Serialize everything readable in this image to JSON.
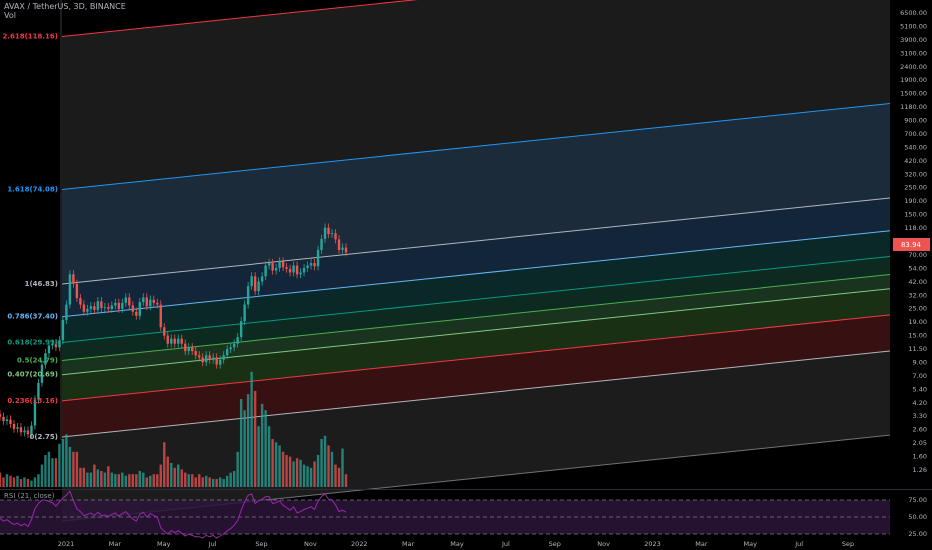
{
  "header": {
    "symbol_line": "AVAX / TetherUS, 3D, BINANCE",
    "volume_label": "Vol"
  },
  "price_badge": "83.94",
  "rsi": {
    "label": "RSI (21, close)",
    "ticks": [
      "75.00",
      "50.00",
      "25.00"
    ],
    "color": "#9c27b0"
  },
  "colors": {
    "up": "#26a69a",
    "down": "#ef5350",
    "volume_up": "#26a69a",
    "volume_down": "#ef5350",
    "badge": "#ef5350"
  },
  "chart_data": {
    "type": "candlestick-log-fib-channel",
    "symbol": "AVAX / TetherUS",
    "interval": "3D",
    "exchange": "BINANCE",
    "y_scale": "log",
    "fib_levels": [
      {
        "label": "0(2.75)",
        "ratio": 0,
        "price": 2.75,
        "color": "#b2b5be"
      },
      {
        "label": "0.236(13.16)",
        "ratio": 0.236,
        "price": 13.16,
        "color": "#f23645"
      },
      {
        "label": "0.407(20.69)",
        "ratio": 0.407,
        "price": 20.69,
        "color": "#81c784"
      },
      {
        "label": "0.5(24.79)",
        "ratio": 0.5,
        "price": 24.79,
        "color": "#4caf50"
      },
      {
        "label": "0.618(29.99)",
        "ratio": 0.618,
        "price": 29.99,
        "color": "#089981"
      },
      {
        "label": "0.786(37.40)",
        "ratio": 0.786,
        "price": 37.4,
        "color": "#64b5f6"
      },
      {
        "label": "1(46.83)",
        "ratio": 1,
        "price": 46.83,
        "color": "#b2b5be"
      },
      {
        "label": "1.618(74.08)",
        "ratio": 1.618,
        "price": 74.08,
        "color": "#2196f3"
      },
      {
        "label": "2.618(118.16)",
        "ratio": 2.618,
        "price": 118.16,
        "color": "#f23645"
      }
    ],
    "y_ticks": [
      "6500.00",
      "5100.00",
      "3900.00",
      "3100.00",
      "2400.00",
      "1900.00",
      "1500.00",
      "1180.00",
      "900.00",
      "700.00",
      "540.00",
      "420.00",
      "320.00",
      "250.00",
      "190.00",
      "150.00",
      "118.00",
      "93.00",
      "70.00",
      "54.00",
      "42.00",
      "32.00",
      "25.00",
      "19.00",
      "15.00",
      "11.50",
      "9.00",
      "7.00",
      "5.40",
      "4.20",
      "3.30",
      "2.60",
      "2.05",
      "1.60",
      "1.26"
    ],
    "x_ticks": [
      "2021",
      "Mar",
      "May",
      "Jul",
      "Sep",
      "Nov",
      "2022",
      "Mar",
      "May",
      "Jul",
      "Sep",
      "Nov",
      "2023",
      "Mar",
      "May",
      "Jul",
      "Sep"
    ],
    "price_close_series": [
      4.0,
      3.7,
      3.8,
      3.5,
      3.2,
      3.3,
      3.0,
      3.1,
      2.9,
      3.4,
      5.5,
      7.5,
      10.5,
      13.0,
      15.0,
      15.5,
      14.5,
      16.5,
      24.0,
      32.0,
      56.0,
      47.0,
      36.0,
      32.0,
      28.0,
      29.5,
      31.0,
      29.0,
      34.0,
      30.0,
      30.5,
      29.5,
      31.5,
      33.0,
      29.5,
      33.0,
      36.5,
      31.5,
      28.0,
      26.0,
      33.5,
      36.5,
      31.0,
      35.0,
      33.0,
      32.0,
      21.0,
      18.0,
      15.5,
      17.0,
      15.5,
      17.0,
      15.5,
      13.5,
      14.5,
      13.5,
      12.5,
      12.0,
      11.0,
      12.5,
      11.5,
      12.0,
      10.5,
      11.5,
      12.5,
      14.0,
      14.5,
      15.5,
      17.5,
      23.5,
      32.0,
      45.0,
      54.0,
      41.0,
      49.0,
      54.0,
      66.0,
      69.0,
      60.0,
      63.0,
      71.0,
      64.0,
      62.0,
      58.0,
      66.0,
      56.0,
      58.0,
      63.0,
      66.0,
      69.0,
      65.0,
      88.0,
      108.0,
      133.0,
      118.0,
      120.0,
      107.0,
      88.0,
      92.0,
      83.94
    ],
    "volume_series": [
      9,
      6,
      8,
      7,
      6,
      7,
      5,
      6,
      5,
      4,
      6,
      8,
      14,
      20,
      22,
      18,
      18,
      27,
      30,
      33,
      25,
      22,
      22,
      12,
      12,
      9,
      9,
      14,
      11,
      10,
      9,
      13,
      9,
      8,
      8,
      9,
      7,
      8,
      8,
      8,
      10,
      9,
      6,
      7,
      8,
      8,
      14,
      28,
      19,
      15,
      12,
      14,
      11,
      9,
      8,
      8,
      6,
      8,
      6,
      7,
      6,
      5,
      5,
      6,
      5,
      7,
      9,
      10,
      22,
      55,
      48,
      58,
      72,
      60,
      38,
      52,
      48,
      38,
      30,
      28,
      26,
      22,
      20,
      19,
      16,
      18,
      17,
      14,
      13,
      12,
      16,
      20,
      30,
      32,
      26,
      22,
      14,
      12,
      24,
      8
    ],
    "rsi_series": [
      48,
      44,
      46,
      42,
      39,
      41,
      37,
      40,
      36,
      46,
      62,
      70,
      75,
      75,
      73,
      71,
      66,
      72,
      78,
      82,
      88,
      74,
      62,
      58,
      52,
      54,
      56,
      52,
      57,
      52,
      53,
      51,
      54,
      56,
      51,
      55,
      58,
      52,
      47,
      44,
      54,
      57,
      50,
      55,
      52,
      50,
      34,
      29,
      25,
      30,
      27,
      30,
      26,
      22,
      25,
      23,
      21,
      21,
      19,
      23,
      21,
      23,
      19,
      22,
      25,
      30,
      33,
      38,
      45,
      60,
      72,
      82,
      84,
      70,
      74,
      76,
      80,
      80,
      70,
      71,
      74,
      67,
      64,
      60,
      65,
      56,
      58,
      61,
      63,
      65,
      61,
      73,
      80,
      84,
      76,
      75,
      68,
      58,
      60,
      57
    ]
  }
}
